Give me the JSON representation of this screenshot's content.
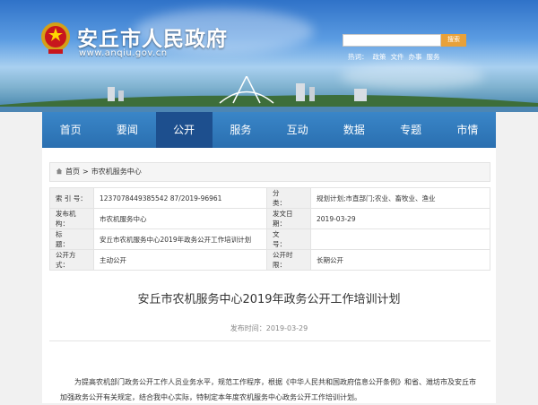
{
  "header": {
    "site_title": "安丘市人民政府",
    "site_url": "www.anqiu.gov.cn",
    "search": {
      "placeholder": "",
      "button_label": "搜索"
    },
    "hotwords_label": "热词：",
    "hotwords": [
      "政策",
      "文件",
      "办事",
      "服务"
    ]
  },
  "nav": {
    "items": [
      "首页",
      "要闻",
      "公开",
      "服务",
      "互动",
      "数据",
      "专题",
      "市情"
    ],
    "active": "公开"
  },
  "breadcrumb": {
    "home": "首页",
    "separator": ">",
    "current": "市农机服务中心"
  },
  "meta": {
    "index_label": "索 引 号：",
    "index_value": "1237078449385542 87/2019-96961",
    "category_label": "分　　类：",
    "category_value": "规划计划;市直部门;农业、畜牧业、渔业",
    "publisher_label": "发布机构：",
    "publisher_value": "市农机服务中心",
    "date_label": "发文日期：",
    "date_value": "2019-03-29",
    "title_label": "标　　题：",
    "title_value": "安丘市农机服务中心2019年政务公开工作培训计划",
    "docno_label": "文　　号：",
    "docno_value": "",
    "method_label": "公开方式：",
    "method_value": "主动公开",
    "period_label": "公开时限：",
    "period_value": "长期公开"
  },
  "article": {
    "title": "安丘市农机服务中心2019年政务公开工作培训计划",
    "pubdate": "发布时间：2019-03-29",
    "body": "为提高农机部门政务公开工作人员业务水平，规范工作程序，根据《中华人民共和国政府信息公开条例》和省、潍坊市及安丘市加强政务公开有关规定，结合我中心实际，特制定本年度农机服务中心政务公开工作培训计划。"
  },
  "colors": {
    "nav_bg": "#2a6fb0",
    "nav_active": "#1d4f8e",
    "search_button": "#e8a13a"
  }
}
